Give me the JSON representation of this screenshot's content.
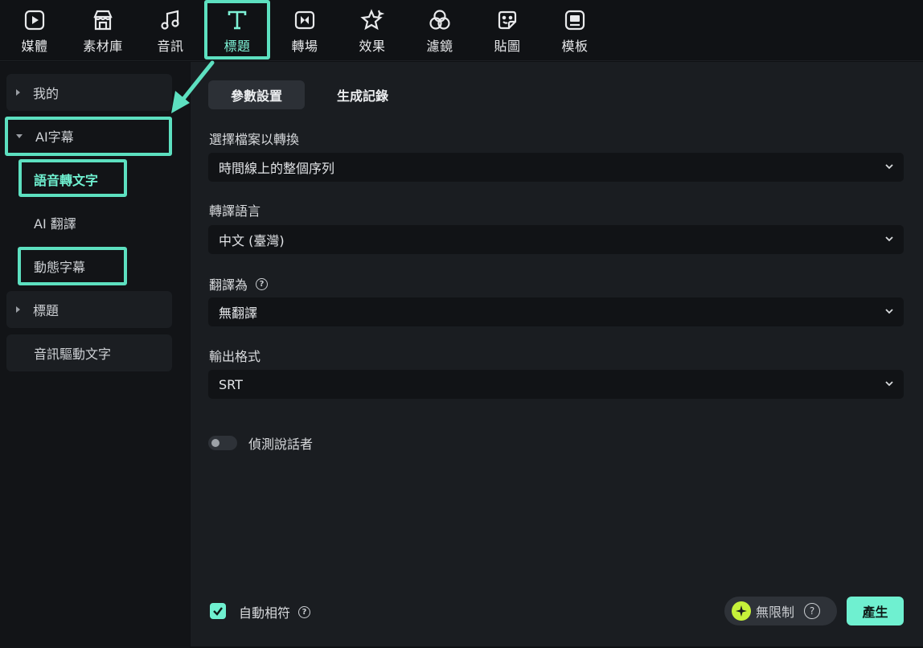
{
  "toolbar": {
    "items": [
      {
        "label": "媒體",
        "icon": "media-icon"
      },
      {
        "label": "素材庫",
        "icon": "store-icon"
      },
      {
        "label": "音訊",
        "icon": "music-icon"
      },
      {
        "label": "標題",
        "icon": "title-text-icon"
      },
      {
        "label": "轉場",
        "icon": "transition-icon"
      },
      {
        "label": "效果",
        "icon": "effects-star-icon"
      },
      {
        "label": "濾鏡",
        "icon": "filter-icon"
      },
      {
        "label": "貼圖",
        "icon": "sticker-icon"
      },
      {
        "label": "模板",
        "icon": "template-icon"
      }
    ],
    "active": "標題"
  },
  "sidebar": {
    "items": [
      {
        "label": "我的"
      },
      {
        "label": "AI字幕"
      },
      {
        "label": "語音轉文字"
      },
      {
        "label": "AI 翻譯"
      },
      {
        "label": "動態字幕"
      },
      {
        "label": "標題"
      },
      {
        "label": "音訊驅動文字"
      }
    ]
  },
  "main": {
    "tabs": [
      {
        "label": "參數設置"
      },
      {
        "label": "生成記錄"
      }
    ],
    "fields": [
      {
        "label": "選擇檔案以轉換",
        "value": "時間線上的整個序列"
      },
      {
        "label": "轉譯語言",
        "value": "中文 (臺灣)"
      },
      {
        "label": "翻譯為",
        "value": "無翻譯"
      },
      {
        "label": "輸出格式",
        "value": "SRT"
      }
    ],
    "toggle": {
      "label": "偵測說話者",
      "on": false
    },
    "checkbox": {
      "label": "自動相符",
      "checked": true
    },
    "unlimited_label": "無限制",
    "generate_label": "產生"
  },
  "colors": {
    "accent": "#6ff0d0",
    "highlight": "#5de0c0",
    "spark": "#c6f23a"
  }
}
